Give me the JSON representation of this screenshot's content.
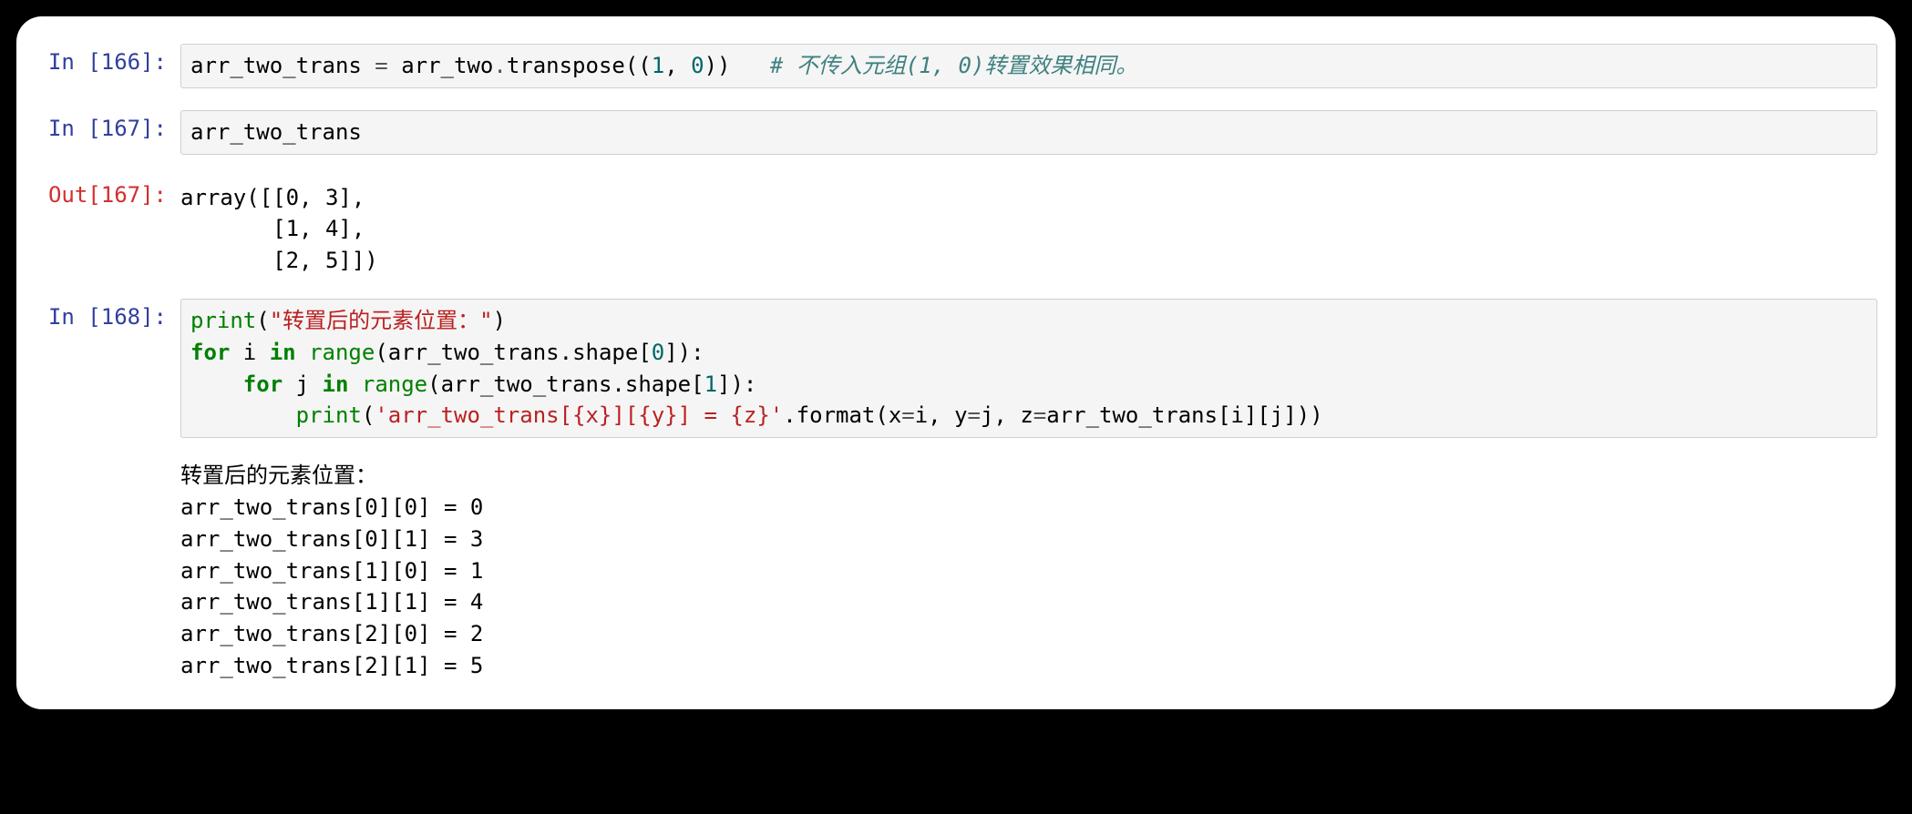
{
  "cells": [
    {
      "prompt_in": "In [166]:",
      "code": {
        "var1": "arr_two_trans",
        "eq": " = ",
        "var2": "arr_two",
        "dot": ".",
        "method": "transpose",
        "lp": "((",
        "n1": "1",
        "comma": ", ",
        "n0": "0",
        "rp": "))",
        "spaces": "   ",
        "comment": "# 不传入元组(1, 0)转置效果相同。"
      }
    },
    {
      "prompt_in": "In [167]:",
      "code_plain": "arr_two_trans"
    },
    {
      "prompt_out": "Out[167]:",
      "output": "array([[0, 3],\n       [1, 4],\n       [2, 5]])"
    },
    {
      "prompt_in": "In [168]:",
      "code168": {
        "print1": "print",
        "lp1": "(",
        "str1": "\"转置后的元素位置：\"",
        "rp1": ")",
        "for1": "for",
        "i": " i ",
        "in1": "in",
        "range1": " range",
        "lp2": "(",
        "arr1": "arr_two_trans",
        "shape1": ".shape[",
        "n0": "0",
        "rb1": "]):",
        "indent1": "    ",
        "for2": "for",
        "j": " j ",
        "in2": "in",
        "range2": " range",
        "lp3": "(",
        "arr2": "arr_two_trans",
        "shape2": ".shape[",
        "n1": "1",
        "rb2": "]):",
        "indent2": "        ",
        "print2": "print",
        "lp4": "(",
        "str2": "'arr_two_trans[{x}][{y}] = {z}'",
        "format": ".format(x",
        "eq1": "=",
        "iarg": "i, y",
        "eq2": "=",
        "jarg": "j, z",
        "eq3": "=",
        "arr3": "arr_two_trans[i][j]))"
      }
    },
    {
      "stdout": "转置后的元素位置：\narr_two_trans[0][0] = 0\narr_two_trans[0][1] = 3\narr_two_trans[1][0] = 1\narr_two_trans[1][1] = 4\narr_two_trans[2][0] = 2\narr_two_trans[2][1] = 5"
    }
  ]
}
